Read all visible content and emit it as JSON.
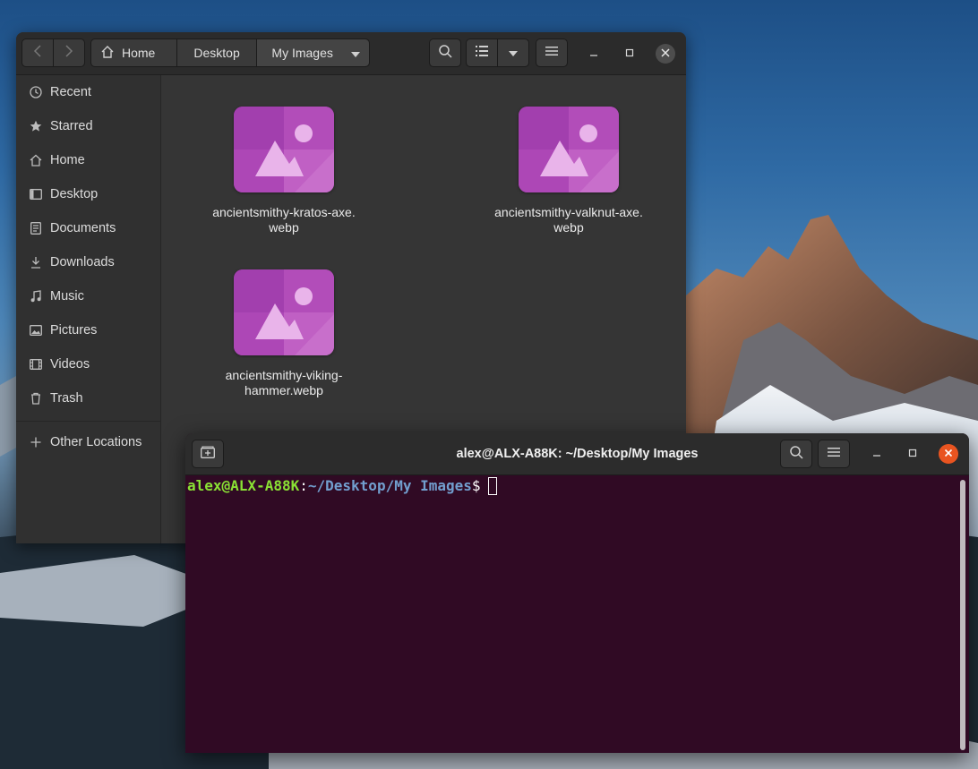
{
  "file_manager": {
    "breadcrumbs": [
      "Home",
      "Desktop",
      "My Images"
    ],
    "sidebar": [
      {
        "label": "Recent",
        "icon": "clock-icon"
      },
      {
        "label": "Starred",
        "icon": "star-icon"
      },
      {
        "label": "Home",
        "icon": "home-icon"
      },
      {
        "label": "Desktop",
        "icon": "desktop-icon"
      },
      {
        "label": "Documents",
        "icon": "document-icon"
      },
      {
        "label": "Downloads",
        "icon": "download-icon"
      },
      {
        "label": "Music",
        "icon": "music-icon"
      },
      {
        "label": "Pictures",
        "icon": "pictures-icon"
      },
      {
        "label": "Videos",
        "icon": "video-icon"
      },
      {
        "label": "Trash",
        "icon": "trash-icon"
      }
    ],
    "other_locations": "Other Locations",
    "files": [
      {
        "name_line1": "ancientsmithy-kratos-axe.",
        "name_line2": "webp"
      },
      {
        "name_line1": "ancientsmithy-valknut-axe.",
        "name_line2": "webp"
      },
      {
        "name_line1": "ancientsmithy-viking-",
        "name_line2": "hammer.webp"
      }
    ],
    "thumbnail_color": "#b34ab3"
  },
  "terminal": {
    "title": "alex@ALX-A88K: ~/Desktop/My Images",
    "prompt_user": "alex@ALX-A88K",
    "prompt_colon": ":",
    "prompt_path": "~/Desktop/My Images",
    "prompt_dollar": "$",
    "background": "#300a24",
    "close_color": "#e95420"
  }
}
